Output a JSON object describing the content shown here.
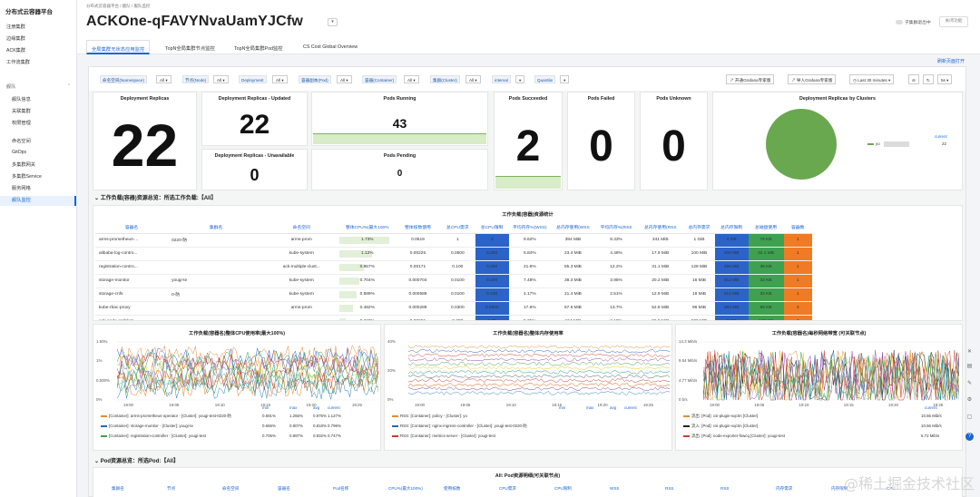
{
  "sidebar": {
    "title": "分布式云容器平台",
    "top_items": [
      "注册集群",
      "边缘集群",
      "ACK集群",
      "工作流集群"
    ],
    "group_label": "舰队",
    "sub_items": [
      "舰队信息",
      "关联集群",
      "权限管理"
    ],
    "sub_items2": [
      "命名空间",
      "GitOps",
      "多集群网关",
      "多集群Service",
      "服务网格",
      "舰队监控"
    ]
  },
  "topbar": {
    "breadcrumb": "分布式云容器平台   /   舰队   /   舰队监控",
    "title": "ACKOne-qFAVYNvaUamYJCfw",
    "toggle_label": "子集群退出中",
    "grey_button": "关闭功能"
  },
  "tabs": [
    "全局集群无状态应用监控",
    "TopN全局集群节点监控",
    "TopN全局集群Pod监控",
    "CS Cost Global Overview"
  ],
  "reset_link": "刷新页面打开",
  "filters": {
    "namespace_label": "命名空间(Namespace)",
    "namespace_value": "All",
    "node_label": "节点(Node)",
    "node_value": "All",
    "deployment_label": "Deployment",
    "deployment_value": "All",
    "pod_label": "容器副本(Pod)",
    "pod_value": "All",
    "container_label": "容器(Container)",
    "container_value": "All",
    "cluster_label": "集群(Cluster)",
    "cluster_value": "All",
    "interval_label": "interval",
    "interval_value": "",
    "quantile_label": "Quantile",
    "quantile_value": "",
    "btn_grafana": "开通Grafana专家版",
    "btn_import": "导入Grafana专家版",
    "time_range": "Last 30 minutes",
    "refresh": "5s"
  },
  "stats": {
    "deployment_replicas": {
      "title": "Deployment Replicas",
      "value": "22"
    },
    "replicas_updated": {
      "title": "Deployment Replicas - Updated",
      "value": "22"
    },
    "replicas_unavailable": {
      "title": "Deployment Replicas - Unavailable",
      "value": "0"
    },
    "pods_running": {
      "title": "Pods Running",
      "value": "43"
    },
    "pods_pending": {
      "title": "Pods Pending",
      "value": "0"
    },
    "pods_succeeded": {
      "title": "Pods Succeeded",
      "value": "2"
    },
    "pods_failed": {
      "title": "Pods Failed",
      "value": "0"
    },
    "pods_unknown": {
      "title": "Pods Unknown",
      "value": "0"
    }
  },
  "pie": {
    "title": "Deployment Replicas by Clusters",
    "legend_header": "current",
    "legend_label": "yo",
    "legend_value": "22",
    "color": "#6aa84f"
  },
  "workload_section": "工作负载(容器)资源总览：所选工作负载:【All】",
  "table": {
    "title": "工作负载(容器)资源统计",
    "headers": [
      "容器名",
      "集群名",
      "命名空间",
      "整体CPU%(最大100%",
      "整体核数使用",
      "总CPU需求",
      "总CPU限制",
      "平均内存%(WSS)",
      "总内存使用(WSS",
      "平均内存%(RSS",
      "总内存使用(RSS",
      "总内存需求",
      "总内存限制",
      "总磁盘使用",
      "容器数"
    ],
    "rows": [
      [
        "arms-prometheus-...",
        "0220-防",
        "arms-prom",
        "1.73%",
        "0.0519",
        "1",
        "3",
        "9.62%",
        "394 MiB",
        "8.33%",
        "341 MiB",
        "1 GiB",
        "4 GB",
        "76 KB",
        "1"
      ],
      [
        "alibaba-log-contro...",
        "",
        "kube-system",
        "1.12%",
        "0.00225",
        "0.0500",
        "0.200",
        "5.84%",
        "23.4 MiB",
        "4.48%",
        "17.9 MiB",
        "100 MiB",
        "400 MB",
        "32.1 MB",
        "1"
      ],
      [
        "registration-contro...",
        "",
        "ack-multiple-clust...",
        "0.857%",
        "0.00171",
        "0.100",
        "0.200",
        "21.6%",
        "55.3 MiB",
        "12.2%",
        "31.1 MiB",
        "128 MiB",
        "256 MB",
        "36 KB",
        "1"
      ],
      [
        "storage-monitor",
        "yougi-te",
        "kube-system",
        "0.704%",
        "0.000704",
        "0.0100",
        "0.100",
        "7.48%",
        "38.3 MiB",
        "3.95%",
        "20.2 MiB",
        "16 MiB",
        "512 MB",
        "32 KB",
        "1"
      ],
      [
        "storage-cnfs",
        "0-防",
        "kube-system",
        "0.589%",
        "0.000589",
        "0.0100",
        "0.100",
        "4.17%",
        "21.4 MiB",
        "2.51%",
        "12.9 MiB",
        "16 MiB",
        "512 MB",
        "32 KB",
        "1"
      ],
      [
        "kube-rbac-proxy",
        "",
        "arms-prom",
        "0.482%",
        "0.000289",
        "0.0300",
        "0.0600",
        "17.6%",
        "67.6 MiB",
        "13.7%",
        "52.8 MiB",
        "96 MiB",
        "384 MB",
        "96 KB",
        "3"
      ],
      [
        "ack-node-problem-...",
        "",
        "",
        "0.227%",
        "0.00681",
        "0.300",
        "1.80",
        "5.35%",
        "164 MiB",
        "2.18%",
        "66.9 MiB",
        "600 MiB",
        "2 GB",
        "120 KB",
        "3"
      ]
    ]
  },
  "charts": [
    {
      "title": "工作负载(容器名)整体CPU使用率(最大100%)",
      "yticks": [
        "1.50%",
        "1%",
        "0.500%",
        "0%"
      ],
      "xticks": [
        "19:00",
        "19:05",
        "19:10",
        "19:15",
        "19:20",
        "19:25"
      ],
      "legend_cols": [
        "min",
        "max",
        "avg",
        "current"
      ],
      "legend": [
        {
          "label": "[Container]: arms-prometheus-operator - [Cluster]: yougi-test-0220-防",
          "color": "#e58a3a",
          "vals": [
            "0.691%",
            "1.266%",
            "0.975%",
            "1.127%"
          ]
        },
        {
          "label": "[Container]: storage-monitor - [Cluster]: yougi-te",
          "color": "#2b63c9",
          "vals": [
            "0.666%",
            "0.907%",
            "0.818%",
            "0.799%"
          ]
        },
        {
          "label": "[Container]: registration-controller - [Cluster]: yougi-test",
          "color": "#3ea14f",
          "vals": [
            "0.706%",
            "0.897%",
            "0.832%",
            "0.747%"
          ]
        }
      ]
    },
    {
      "title": "工作负载(容器名)整体内存使用率",
      "yticks": [
        "40%",
        "20%",
        "0%"
      ],
      "xticks": [
        "19:00",
        "19:05",
        "19:10",
        "19:15",
        "19:20",
        "19:25"
      ],
      "legend_cols": [
        "min",
        "max",
        "avg",
        "current"
      ],
      "legend": [
        {
          "label": "RSS:  [Container]: policy - [Cluster]: yo",
          "color": "#e58a3a",
          "vals": []
        },
        {
          "label": "RSS:  [Container]: nginx-ingress-controller - [Cluster]: yougi-test-0220-防",
          "color": "#2b63c9",
          "vals": []
        },
        {
          "label": "RSS:  [Container]: metrics-server - [Cluster]: yougi-test",
          "color": "#d23b2a",
          "vals": []
        }
      ]
    },
    {
      "title": "工作负载(容器名)每秒网络带宽 (可关联节点)",
      "yticks": [
        "14.3 Mib/s",
        "9.54 Mib/s",
        "4.77 Mib/s",
        "0 b/s"
      ],
      "xticks": [
        "19:00",
        "19:05",
        "19:10",
        "19:15",
        "19:20",
        "19:25"
      ],
      "legend_cols": [
        "current"
      ],
      "legend": [
        {
          "label": "流出: [Pod]: csi-plugin-vqctm [Cluster]",
          "color": "#e58a3a",
          "vals": [
            "10.56 Mib/s"
          ]
        },
        {
          "label": "流入: [Pod]: csi-plugin-vqctm [Cluster]",
          "color": "#222222",
          "vals": [
            "10.56 Mib/s"
          ]
        },
        {
          "label": "流出: [Pod]: node-exporter-fswcq [Cluster]: yougi-test",
          "color": "#d23b2a",
          "vals": [
            "5.72 Mib/s"
          ]
        }
      ]
    }
  ],
  "pod_section": "Pod资源总览：所选Pod:【All】",
  "pod_table_title": "All: Pod资源明细(可关联节点)",
  "pod_headers": [
    "集群名",
    "节点",
    "命名空间",
    "容器名",
    "Pod名称",
    "CPU%(最大100%)",
    "使用核数",
    "CPU需求",
    "CPU限制",
    "WSS",
    "RSS",
    "RSS",
    "内存需求",
    "内存限制",
    "CPU"
  ],
  "watermark": "@稀土掘金技术社区"
}
